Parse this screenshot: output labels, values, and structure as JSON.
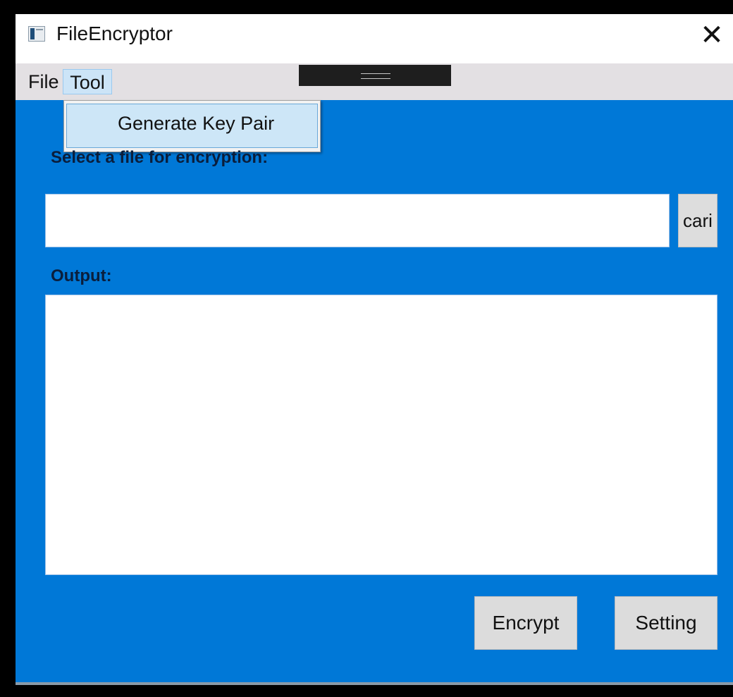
{
  "window": {
    "title": "FileEncryptor",
    "close_glyph": "✕",
    "app_icon": "app-icon",
    "colors": {
      "background": "#0078d7",
      "menubar": "#e3e0e3",
      "menu_highlight": "#cce4f7"
    }
  },
  "menubar": {
    "items": [
      {
        "label": "File"
      },
      {
        "label": "Tool"
      }
    ]
  },
  "dropdown": {
    "items": [
      {
        "label": "Generate Key Pair"
      }
    ]
  },
  "form": {
    "select_label": "Select a file for encryption:",
    "file_input_value": "",
    "file_input_placeholder": "",
    "browse_label": "cari",
    "output_label": "Output:",
    "output_value": ""
  },
  "actions": {
    "encrypt_label": "Encrypt",
    "setting_label": "Setting"
  }
}
